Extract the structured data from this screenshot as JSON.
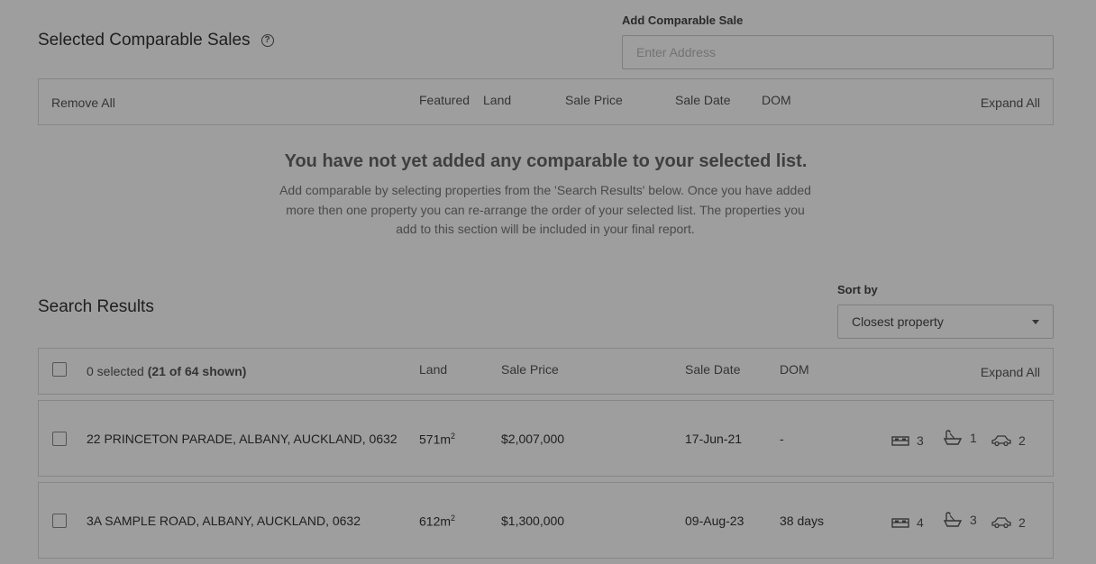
{
  "selected": {
    "title": "Selected Comparable Sales",
    "help_icon": "question-circle-icon",
    "add_label": "Add Comparable Sale",
    "add_placeholder": "Enter Address",
    "header": {
      "remove_all": "Remove All",
      "featured": "Featured",
      "land": "Land",
      "sale_price": "Sale Price",
      "sale_date": "Sale Date",
      "dom": "DOM",
      "expand_all": "Expand All"
    },
    "empty_title": "You have not yet added any comparable to your selected list.",
    "empty_desc": "Add comparable by selecting properties from the 'Search Results' below. Once you have added more then one property you can re-arrange the order of your selected list. The properties you add to this section will be included in your final report."
  },
  "search": {
    "title": "Search Results",
    "sort_label": "Sort by",
    "sort_value": "Closest property",
    "header": {
      "selected_count": "0 selected",
      "shown": "(21 of 64 shown)",
      "land": "Land",
      "sale_price": "Sale Price",
      "sale_date": "Sale Date",
      "dom": "DOM",
      "expand_all": "Expand All"
    },
    "rows": [
      {
        "address": "22 PRINCETON PARADE, ALBANY, AUCKLAND, 0632",
        "land": "571m",
        "land_sup": "2",
        "price": "$2,007,000",
        "date": "17-Jun-21",
        "dom": "-",
        "beds": "3",
        "baths": "1",
        "cars": "2"
      },
      {
        "address": "3A SAMPLE ROAD, ALBANY, AUCKLAND, 0632",
        "land": "612m",
        "land_sup": "2",
        "price": "$1,300,000",
        "date": "09-Aug-23",
        "dom": "38 days",
        "beds": "4",
        "baths": "3",
        "cars": "2"
      }
    ]
  },
  "colors": {
    "overlay": "#000000",
    "link": "#3a6ea8"
  }
}
